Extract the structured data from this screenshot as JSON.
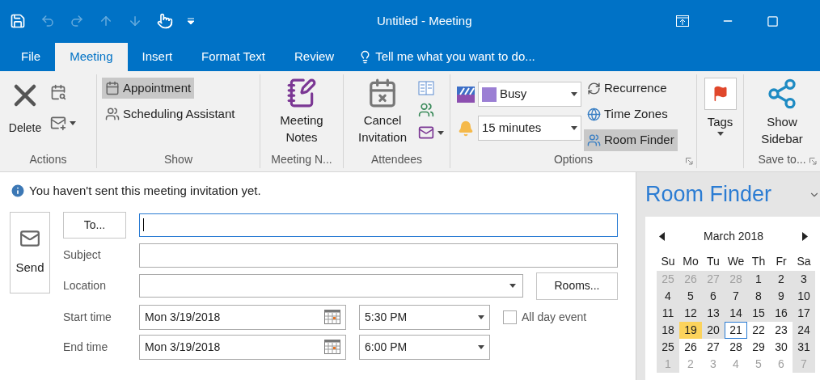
{
  "window": {
    "title": "Untitled - Meeting"
  },
  "tabs": [
    {
      "label": "File",
      "selected": false
    },
    {
      "label": "Meeting",
      "selected": true
    },
    {
      "label": "Insert",
      "selected": false
    },
    {
      "label": "Format Text",
      "selected": false
    },
    {
      "label": "Review",
      "selected": false
    }
  ],
  "tell_me": "Tell me what you want to do...",
  "ribbon": {
    "actions": {
      "label": "Actions",
      "delete": "Delete"
    },
    "show": {
      "label": "Show",
      "items": [
        {
          "label": "Appointment",
          "selected": true
        },
        {
          "label": "Scheduling Assistant",
          "selected": false
        }
      ]
    },
    "meeting_notes": {
      "label": "Meeting N...",
      "button": "Meeting Notes"
    },
    "attendees": {
      "label": "Attendees",
      "button": "Cancel Invitation"
    },
    "options": {
      "label": "Options",
      "show_as": "Busy",
      "reminder": "15 minutes",
      "items": [
        {
          "label": "Recurrence",
          "selected": false
        },
        {
          "label": "Time Zones",
          "selected": false
        },
        {
          "label": "Room Finder",
          "selected": true
        }
      ]
    },
    "tags": {
      "label": "Tags"
    },
    "save_to": {
      "label": "Save to...",
      "button": "Show Sidebar"
    }
  },
  "form": {
    "info": "You haven't sent this meeting invitation yet.",
    "send": "Send",
    "to_button": "To...",
    "subject_label": "Subject",
    "location_label": "Location",
    "rooms_button": "Rooms...",
    "start_label": "Start time",
    "start_date": "Mon 3/19/2018",
    "start_time": "5:30 PM",
    "all_day": {
      "label": "All day event",
      "checked": false
    },
    "end_label": "End time",
    "end_date": "Mon 3/19/2018",
    "end_time": "6:00 PM"
  },
  "room_finder": {
    "title": "Room Finder",
    "month": "March 2018",
    "weekdays": [
      "Su",
      "Mo",
      "Tu",
      "We",
      "Th",
      "Fr",
      "Sa"
    ],
    "days": [
      {
        "d": "25",
        "muted": true,
        "shaded": true,
        "selected": false,
        "today": false
      },
      {
        "d": "26",
        "muted": true,
        "shaded": true,
        "selected": false,
        "today": false
      },
      {
        "d": "27",
        "muted": true,
        "shaded": true,
        "selected": false,
        "today": false
      },
      {
        "d": "28",
        "muted": true,
        "shaded": true,
        "selected": false,
        "today": false
      },
      {
        "d": "1",
        "muted": false,
        "shaded": true,
        "selected": false,
        "today": false
      },
      {
        "d": "2",
        "muted": false,
        "shaded": true,
        "selected": false,
        "today": false
      },
      {
        "d": "3",
        "muted": false,
        "shaded": true,
        "selected": false,
        "today": false
      },
      {
        "d": "4",
        "muted": false,
        "shaded": true,
        "selected": false,
        "today": false
      },
      {
        "d": "5",
        "muted": false,
        "shaded": true,
        "selected": false,
        "today": false
      },
      {
        "d": "6",
        "muted": false,
        "shaded": true,
        "selected": false,
        "today": false
      },
      {
        "d": "7",
        "muted": false,
        "shaded": true,
        "selected": false,
        "today": false
      },
      {
        "d": "8",
        "muted": false,
        "shaded": true,
        "selected": false,
        "today": false
      },
      {
        "d": "9",
        "muted": false,
        "shaded": true,
        "selected": false,
        "today": false
      },
      {
        "d": "10",
        "muted": false,
        "shaded": true,
        "selected": false,
        "today": false
      },
      {
        "d": "11",
        "muted": false,
        "shaded": true,
        "selected": false,
        "today": false
      },
      {
        "d": "12",
        "muted": false,
        "shaded": true,
        "selected": false,
        "today": false
      },
      {
        "d": "13",
        "muted": false,
        "shaded": true,
        "selected": false,
        "today": false
      },
      {
        "d": "14",
        "muted": false,
        "shaded": true,
        "selected": false,
        "today": false
      },
      {
        "d": "15",
        "muted": false,
        "shaded": true,
        "selected": false,
        "today": false
      },
      {
        "d": "16",
        "muted": false,
        "shaded": true,
        "selected": false,
        "today": false
      },
      {
        "d": "17",
        "muted": false,
        "shaded": true,
        "selected": false,
        "today": false
      },
      {
        "d": "18",
        "muted": false,
        "shaded": true,
        "selected": false,
        "today": false
      },
      {
        "d": "19",
        "muted": false,
        "shaded": true,
        "selected": true,
        "today": false
      },
      {
        "d": "20",
        "muted": false,
        "shaded": true,
        "selected": false,
        "today": false
      },
      {
        "d": "21",
        "muted": false,
        "shaded": false,
        "selected": false,
        "today": true
      },
      {
        "d": "22",
        "muted": false,
        "shaded": false,
        "selected": false,
        "today": false
      },
      {
        "d": "23",
        "muted": false,
        "shaded": false,
        "selected": false,
        "today": false
      },
      {
        "d": "24",
        "muted": false,
        "shaded": true,
        "selected": false,
        "today": false
      },
      {
        "d": "25",
        "muted": false,
        "shaded": true,
        "selected": false,
        "today": false
      },
      {
        "d": "26",
        "muted": false,
        "shaded": false,
        "selected": false,
        "today": false
      },
      {
        "d": "27",
        "muted": false,
        "shaded": false,
        "selected": false,
        "today": false
      },
      {
        "d": "28",
        "muted": false,
        "shaded": false,
        "selected": false,
        "today": false
      },
      {
        "d": "29",
        "muted": false,
        "shaded": false,
        "selected": false,
        "today": false
      },
      {
        "d": "30",
        "muted": false,
        "shaded": false,
        "selected": false,
        "today": false
      },
      {
        "d": "31",
        "muted": false,
        "shaded": true,
        "selected": false,
        "today": false
      },
      {
        "d": "1",
        "muted": true,
        "shaded": true,
        "selected": false,
        "today": false
      },
      {
        "d": "2",
        "muted": true,
        "shaded": false,
        "selected": false,
        "today": false
      },
      {
        "d": "3",
        "muted": true,
        "shaded": false,
        "selected": false,
        "today": false
      },
      {
        "d": "4",
        "muted": true,
        "shaded": false,
        "selected": false,
        "today": false
      },
      {
        "d": "5",
        "muted": true,
        "shaded": false,
        "selected": false,
        "today": false
      },
      {
        "d": "6",
        "muted": true,
        "shaded": false,
        "selected": false,
        "today": false
      },
      {
        "d": "7",
        "muted": true,
        "shaded": true,
        "selected": false,
        "today": false
      }
    ]
  }
}
